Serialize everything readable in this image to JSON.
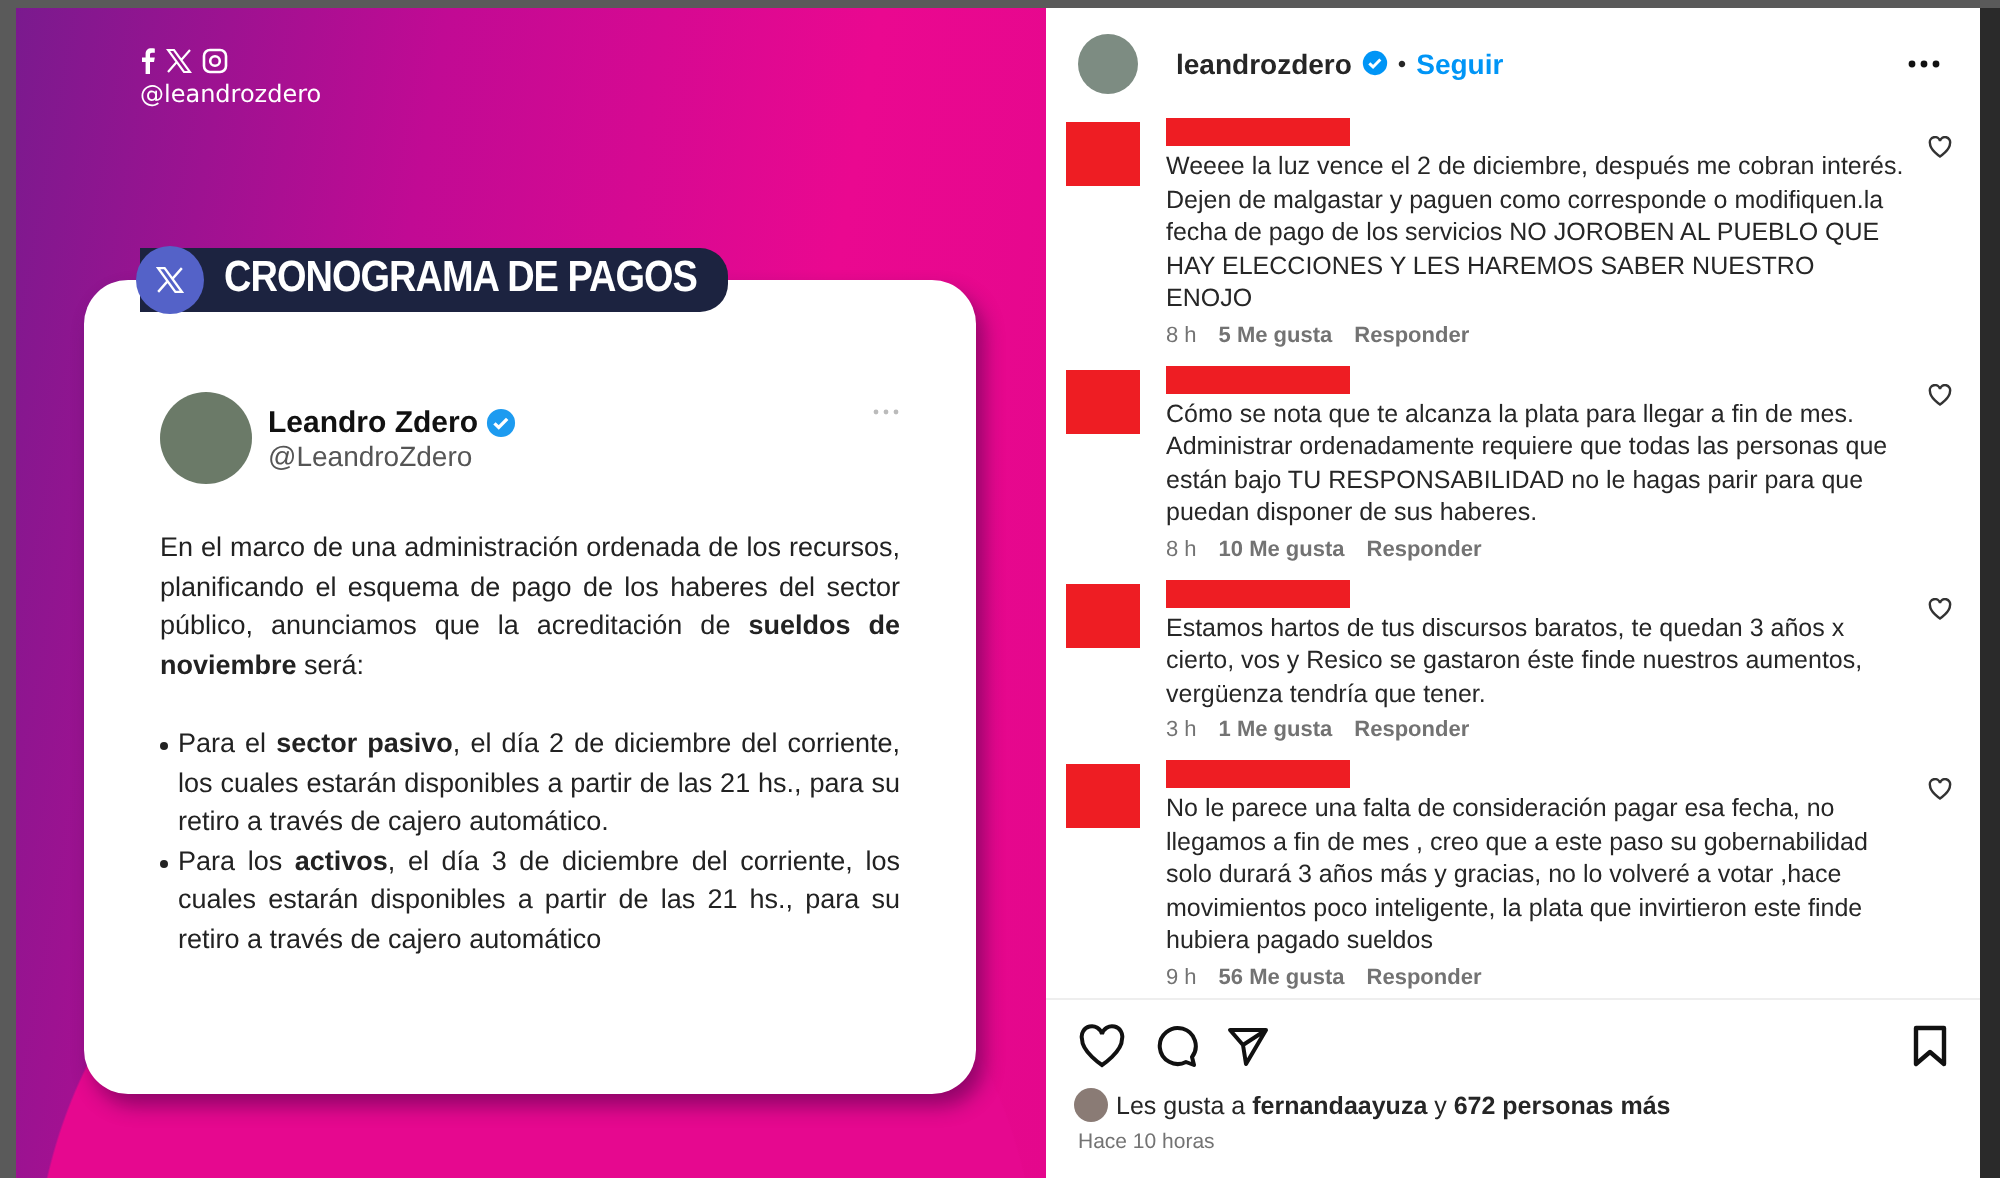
{
  "post_image": {
    "handle": "@leandrozdero",
    "badge": "CRONOGRAMA DE PAGOS",
    "tweet": {
      "name": "Leandro Zdero",
      "verified": true,
      "handle": "@LeandroZdero",
      "intro": "En el marco de una administración ordenada de los recursos, planificando el esquema de pago de los haberes del sector público, anunciamos que la acreditación de **sueldos de noviembre** será:",
      "bullets": [
        "Para el **sector pasivo**, el día 2 de diciembre del corriente, los cuales estarán disponibles a partir de las 21 hs., para su retiro a través de cajero automático.",
        "Para los **activos**, el día 3 de diciembre del corriente, los cuales estarán disponibles a partir de las 21 hs., para su retiro a través de cajero automático"
      ]
    }
  },
  "header": {
    "username": "leandrozdero",
    "verified": true,
    "separator": "•",
    "follow": "Seguir"
  },
  "comments": [
    {
      "text": "Weeee la luz vence el 2 de diciembre, después me cobran interés. Dejen de malgastar y paguen como corresponde o modifiquen.la fecha de pago de los servicios NO JOROBEN AL PUEBLO QUE HAY ELECCIONES Y LES HAREMOS SABER NUESTRO ENOJO",
      "time": "8 h",
      "likes": "5 Me gusta",
      "reply": "Responder"
    },
    {
      "text": "Cómo se nota que te alcanza la plata para llegar a fin de mes. Administrar ordenadamente requiere que todas las personas que están bajo TU RESPONSABILIDAD no le hagas parir para que puedan disponer de sus haberes.",
      "time": "8 h",
      "likes": "10 Me gusta",
      "reply": "Responder"
    },
    {
      "text": "Estamos hartos de tus discursos baratos, te quedan 3 años x cierto, vos y Resico se gastaron éste finde nuestros aumentos, vergüenza tendría que tener.",
      "time": "3 h",
      "likes": "1 Me gusta",
      "reply": "Responder"
    },
    {
      "text": "No le parece una falta de consideración pagar esa fecha, no llegamos a fin de mes , creo que a este paso su gobernabilidad solo durará 3 años más y gracias, no lo volveré a votar ,hace movimientos poco inteligente, la plata que invirtieron este finde hubiera pagado sueldos",
      "time": "9 h",
      "likes": "56 Me gusta",
      "reply": "Responder"
    }
  ],
  "likes_line": "Les gusta a **fernandaayuza** y **672 personas más**",
  "timestamp": "Hace 10 horas"
}
